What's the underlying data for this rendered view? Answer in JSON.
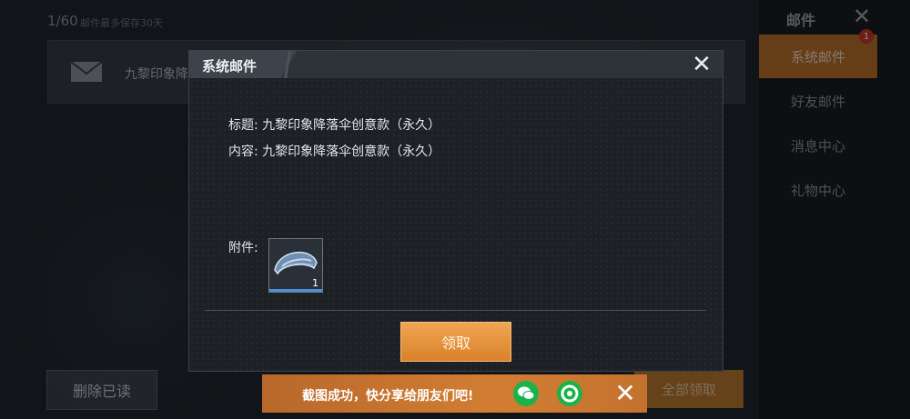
{
  "background": {
    "mail_count": "1/60",
    "mail_note": "邮件最多保存30天",
    "mail_item_title": "九黎印象降落伞",
    "delete_read_label": "删除已读",
    "claim_all_label": "全部领取"
  },
  "sidebar": {
    "title": "邮件",
    "items": [
      {
        "label": "系统邮件",
        "badge": "1",
        "active": true
      },
      {
        "label": "好友邮件"
      },
      {
        "label": "消息中心"
      },
      {
        "label": "礼物中心"
      }
    ]
  },
  "modal": {
    "title": "系统邮件",
    "subject_label": "标题:",
    "subject_value": "九黎印象降落伞创意款（永久）",
    "content_label": "内容:",
    "content_value": "九黎印象降落伞创意款（永久）",
    "attachment_label": "附件:",
    "attachment_item": {
      "icon": "parachute-icon",
      "quantity": "1"
    },
    "claim_label": "领取"
  },
  "toast": {
    "text": "截图成功，快分享给朋友们吧!",
    "icons": [
      "wechat-icon",
      "moments-icon"
    ]
  },
  "colors": {
    "accent_orange": "#d9822a",
    "badge_red": "#c8352a",
    "share_green": "#19b34a"
  }
}
